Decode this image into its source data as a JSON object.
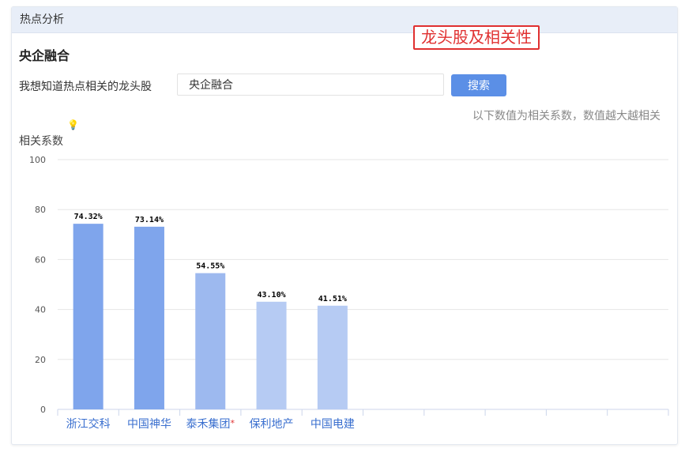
{
  "panel": {
    "title": "热点分析"
  },
  "annotation": {
    "text": "龙头股及相关性"
  },
  "section": {
    "title": "央企融合"
  },
  "query": {
    "label": "我想知道热点相关的龙头股",
    "value": "央企融合",
    "button_label": "搜索"
  },
  "hint": "以下数值为相关系数，数值越大越相关",
  "icons": {
    "bulb": "lightbulb-icon"
  },
  "chart_data": {
    "type": "bar",
    "ylabel": "相关系数",
    "ylim": [
      0,
      100
    ],
    "yticks": [
      0,
      20,
      40,
      60,
      80,
      100
    ],
    "categories": [
      "浙江交科",
      "中国神华",
      "泰禾集团",
      "保利地产",
      "中国电建"
    ],
    "values": [
      74.32,
      73.14,
      54.55,
      43.1,
      41.51
    ],
    "value_labels": [
      "74.32%",
      "73.14%",
      "54.55%",
      "43.10%",
      "41.51%"
    ],
    "category_marks": [
      "",
      "",
      "*",
      "",
      ""
    ],
    "empty_slots": 5,
    "bar_colors": [
      "#7fa5ec",
      "#7fa5ec",
      "#9db9ef",
      "#b6cbf3",
      "#b6cbf3"
    ],
    "category_color": "#3a6fcf",
    "mark_color": "#e03030",
    "grid": true
  }
}
